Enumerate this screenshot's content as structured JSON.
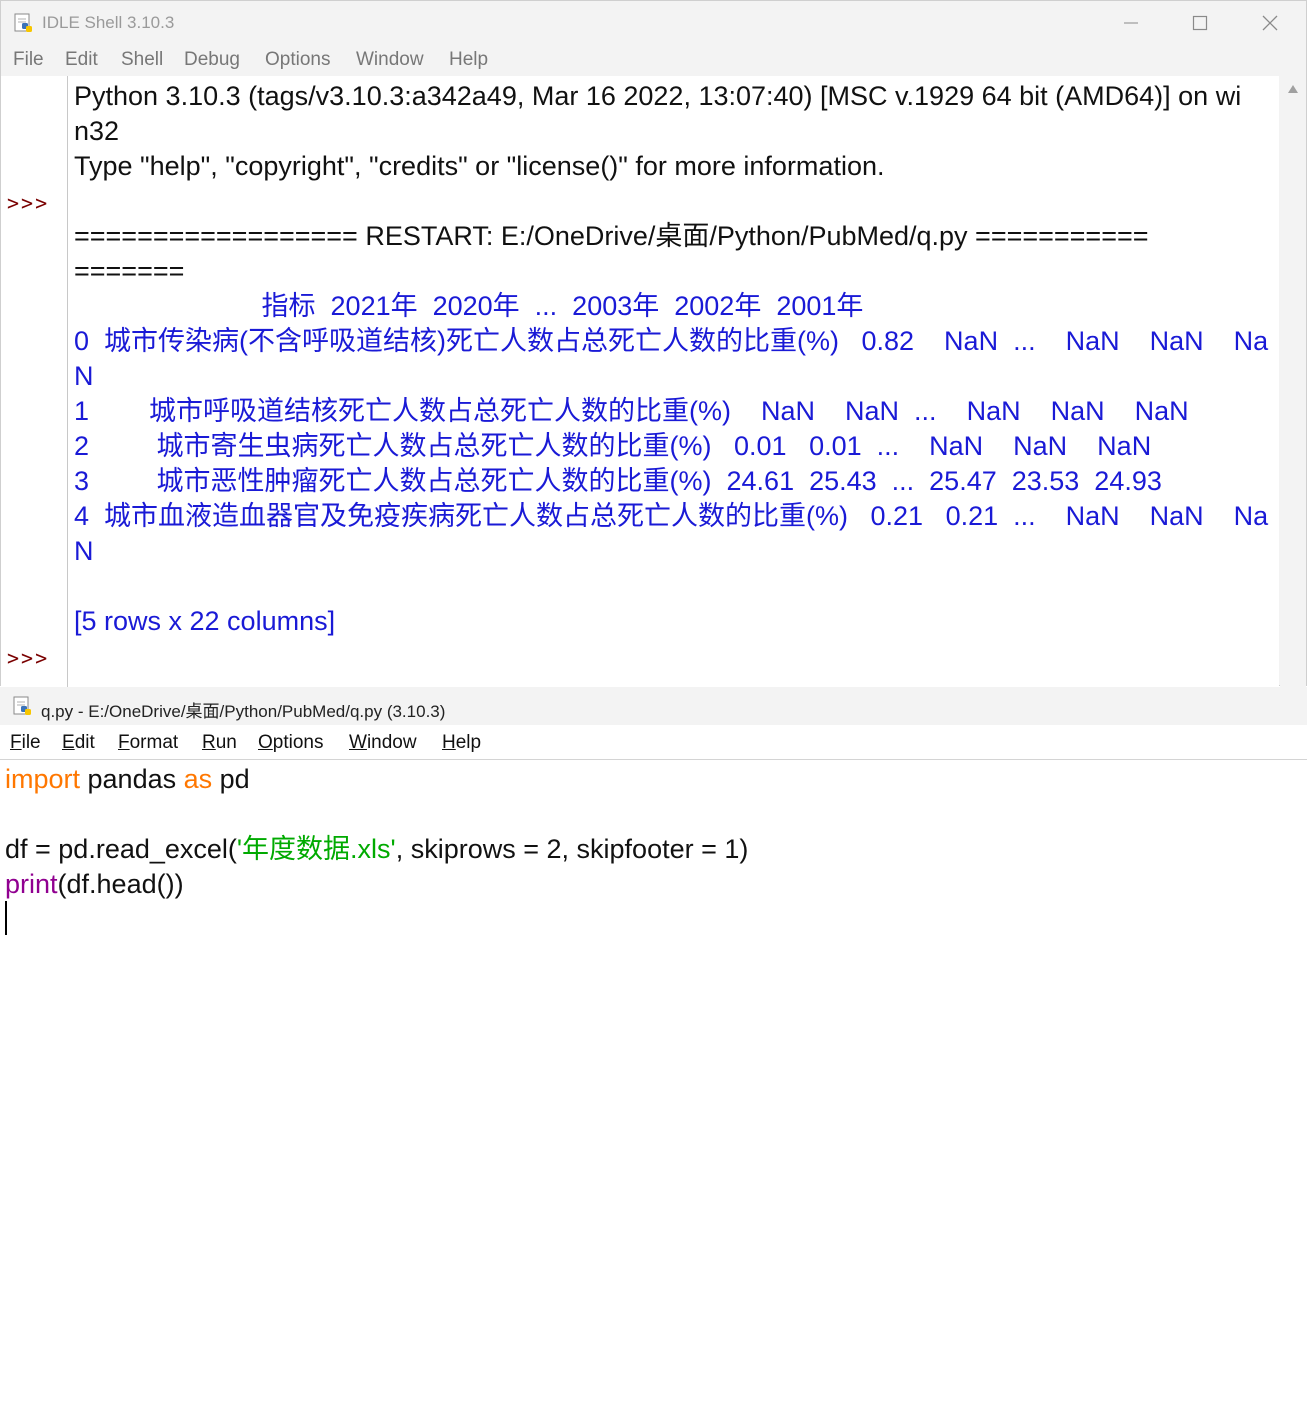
{
  "shell": {
    "title": "IDLE Shell 3.10.3",
    "menu": [
      "File",
      "Edit",
      "Shell",
      "Debug",
      "Options",
      "Window",
      "Help"
    ],
    "prompt": ">>>",
    "lines": [
      "Python 3.10.3 (tags/v3.10.3:a342a49, Mar 16 2022, 13:07:40) [MSC v.1929 64 bit (AMD64)] on wi",
      "n32",
      "Type \"help\", \"copyright\", \"credits\" or \"license()\" for more information.",
      "================== RESTART: E:/OneDrive/桌面/Python/PubMed/q.py ===========",
      "======="
    ],
    "output": [
      "                         指标  2021年  2020年  ...  2003年  2002年  2001年",
      "0  城市传染病(不含呼吸道结核)死亡人数占总死亡人数的比重(%)   0.82    NaN  ...    NaN    NaN    Na",
      "N",
      "1        城市呼吸道结核死亡人数占总死亡人数的比重(%)    NaN    NaN  ...    NaN    NaN    NaN",
      "2         城市寄生虫病死亡人数占总死亡人数的比重(%)   0.01   0.01  ...    NaN    NaN    NaN",
      "3         城市恶性肿瘤死亡人数占总死亡人数的比重(%)  24.61  25.43  ...  25.47  23.53  24.93",
      "4  城市血液造血器官及免疫疾病死亡人数占总死亡人数的比重(%)   0.21   0.21  ...    NaN    NaN    Na",
      "N",
      "[5 rows x 22 columns]"
    ]
  },
  "editor": {
    "title": "q.py - E:/OneDrive/桌面/Python/PubMed/q.py (3.10.3)",
    "menu": [
      "File",
      "Edit",
      "Format",
      "Run",
      "Options",
      "Window",
      "Help"
    ],
    "code": {
      "l1_kw1": "import",
      "l1_mid": " pandas ",
      "l1_kw2": "as",
      "l1_end": " pd",
      "l3_a": "df = pd.read_excel(",
      "l3_str": "'年度数据.xls'",
      "l3_b": ", skiprows = 2, skipfooter = 1)",
      "l4_bi": "print",
      "l4_rest": "(df.head())"
    }
  },
  "colors": {
    "prompt": "#7a0000",
    "output": "#1a1ad6",
    "keyword": "#ff7700",
    "string": "#00aa00",
    "builtin": "#900090"
  },
  "icons": [
    "python-idle-icon",
    "minimize-icon",
    "maximize-icon",
    "close-icon",
    "scroll-up-arrow-icon"
  ]
}
